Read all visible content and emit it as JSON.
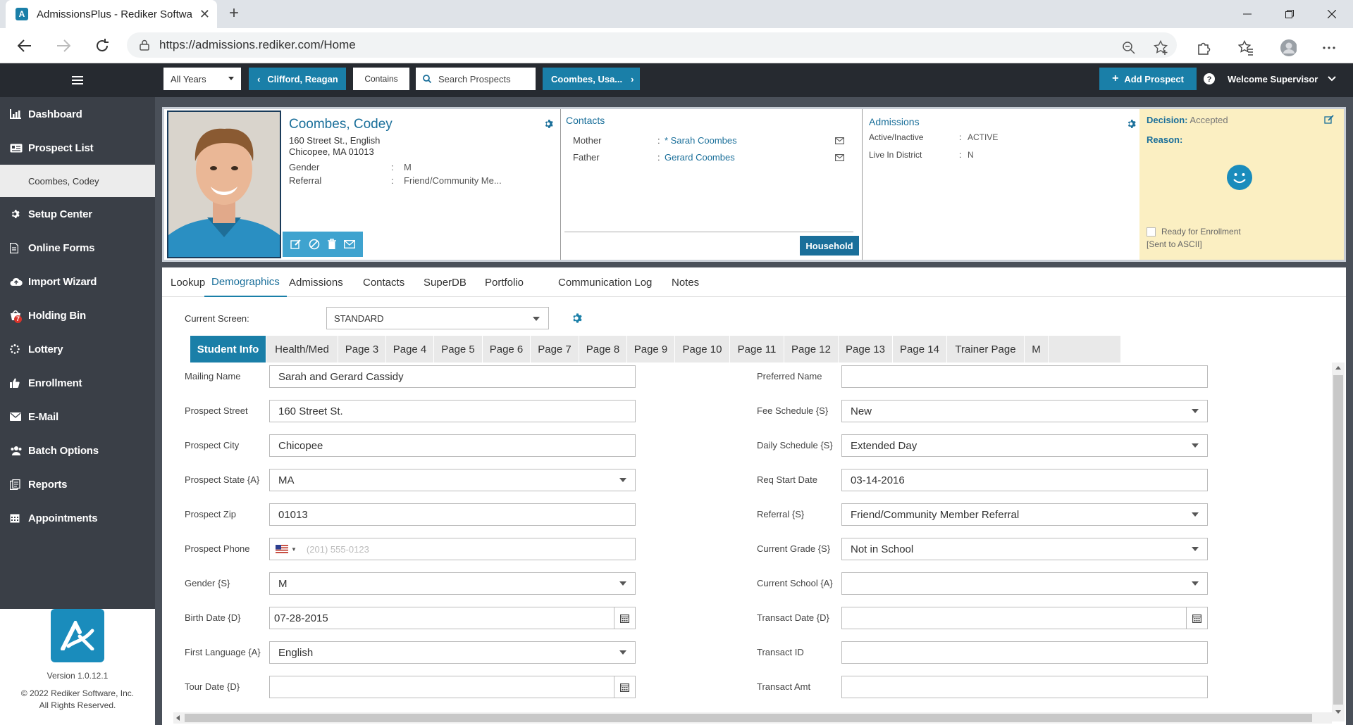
{
  "browser": {
    "tab_title": "AdmissionsPlus - Rediker Softwa",
    "url": "https://admissions.rediker.com/Home"
  },
  "topbar": {
    "year_filter": "All Years",
    "prev_prospect": "Clifford, Reagan",
    "match_mode": "Contains",
    "search_placeholder": "Search Prospects",
    "next_prospect": "Coombes, Usa...",
    "add_prospect": "Add Prospect",
    "welcome": "Welcome Supervisor"
  },
  "sidebar": {
    "items": [
      {
        "label": "Dashboard",
        "icon": "bar-chart-icon"
      },
      {
        "label": "Prospect List",
        "icon": "id-card-icon"
      },
      {
        "label": "Setup Center",
        "icon": "gear-icon"
      },
      {
        "label": "Online Forms",
        "icon": "document-icon"
      },
      {
        "label": "Import Wizard",
        "icon": "cloud-upload-icon"
      },
      {
        "label": "Holding Bin",
        "icon": "holding-bin-icon"
      },
      {
        "label": "Lottery",
        "icon": "spinner-icon"
      },
      {
        "label": "Enrollment",
        "icon": "thumbs-up-icon"
      },
      {
        "label": "E-Mail",
        "icon": "envelope-icon"
      },
      {
        "label": "Batch Options",
        "icon": "users-icon"
      },
      {
        "label": "Reports",
        "icon": "reports-icon"
      },
      {
        "label": "Appointments",
        "icon": "calendar-icon"
      }
    ],
    "sub_item": "Coombes, Codey",
    "holding_badge": "7",
    "version": "Version 1.0.12.1",
    "copyright": "© 2022 Rediker Software, Inc.",
    "rights": "All Rights Reserved."
  },
  "prospect": {
    "name": "Coombes, Codey",
    "address1": "160 Street St., English",
    "address2": "Chicopee, MA 01013",
    "gender_label": "Gender",
    "gender": "M",
    "referral_label": "Referral",
    "referral": "Friend/Community Me..."
  },
  "contacts": {
    "title": "Contacts",
    "mother_label": "Mother",
    "mother": "* Sarah Coombes",
    "father_label": "Father",
    "father": "Gerard Coombes",
    "household": "Household"
  },
  "admissions": {
    "title": "Admissions",
    "active_label": "Active/Inactive",
    "active": "ACTIVE",
    "district_label": "Live In District",
    "district": "N"
  },
  "decision": {
    "label": "Decision:",
    "value": "Accepted",
    "reason_label": "Reason:",
    "ready": "Ready for Enrollment",
    "sent": "[Sent to ASCII]"
  },
  "tabs": [
    "Lookup",
    "Demographics",
    "Admissions",
    "Contacts",
    "SuperDB",
    "Portfolio",
    "Communication Log",
    "Notes"
  ],
  "current_screen": {
    "label": "Current Screen:",
    "value": "STANDARD"
  },
  "page_tabs": [
    "Student Info",
    "Health/Med",
    "Page 3",
    "Page 4",
    "Page 5",
    "Page 6",
    "Page 7",
    "Page 8",
    "Page 9",
    "Page 10",
    "Page 11",
    "Page 12",
    "Page 13",
    "Page 14",
    "Trainer Page",
    "M"
  ],
  "form_left": [
    {
      "label": "Mailing Name",
      "value": "Sarah and Gerard Cassidy",
      "type": "text"
    },
    {
      "label": "Prospect Street",
      "value": "160 Street St.",
      "type": "text"
    },
    {
      "label": "Prospect City",
      "value": "Chicopee",
      "type": "text"
    },
    {
      "label": "Prospect State {A}",
      "value": "MA",
      "type": "select"
    },
    {
      "label": "Prospect Zip",
      "value": "01013",
      "type": "text"
    },
    {
      "label": "Prospect Phone",
      "value": "",
      "placeholder": "(201) 555-0123",
      "type": "phone"
    },
    {
      "label": "Gender {S}",
      "value": "M",
      "type": "select"
    },
    {
      "label": "Birth Date {D}",
      "value": "07-28-2015",
      "type": "date"
    },
    {
      "label": "First Language {A}",
      "value": "English",
      "type": "select"
    },
    {
      "label": "Tour Date {D}",
      "value": "",
      "type": "date"
    }
  ],
  "form_right": [
    {
      "label": "Preferred Name",
      "value": "",
      "type": "text"
    },
    {
      "label": "Fee Schedule {S}",
      "value": "New",
      "type": "select"
    },
    {
      "label": "Daily Schedule {S}",
      "value": "Extended Day",
      "type": "select"
    },
    {
      "label": "Req Start Date",
      "value": "03-14-2016",
      "type": "text"
    },
    {
      "label": "Referral {S}",
      "value": "Friend/Community Member Referral",
      "type": "select"
    },
    {
      "label": "Current Grade {S}",
      "value": "Not in School",
      "type": "select"
    },
    {
      "label": "Current School {A}",
      "value": "",
      "type": "select"
    },
    {
      "label": "Transact Date {D}",
      "value": "",
      "type": "date"
    },
    {
      "label": "Transact ID",
      "value": "",
      "type": "text"
    },
    {
      "label": "Transact Amt",
      "value": "",
      "type": "text"
    }
  ]
}
